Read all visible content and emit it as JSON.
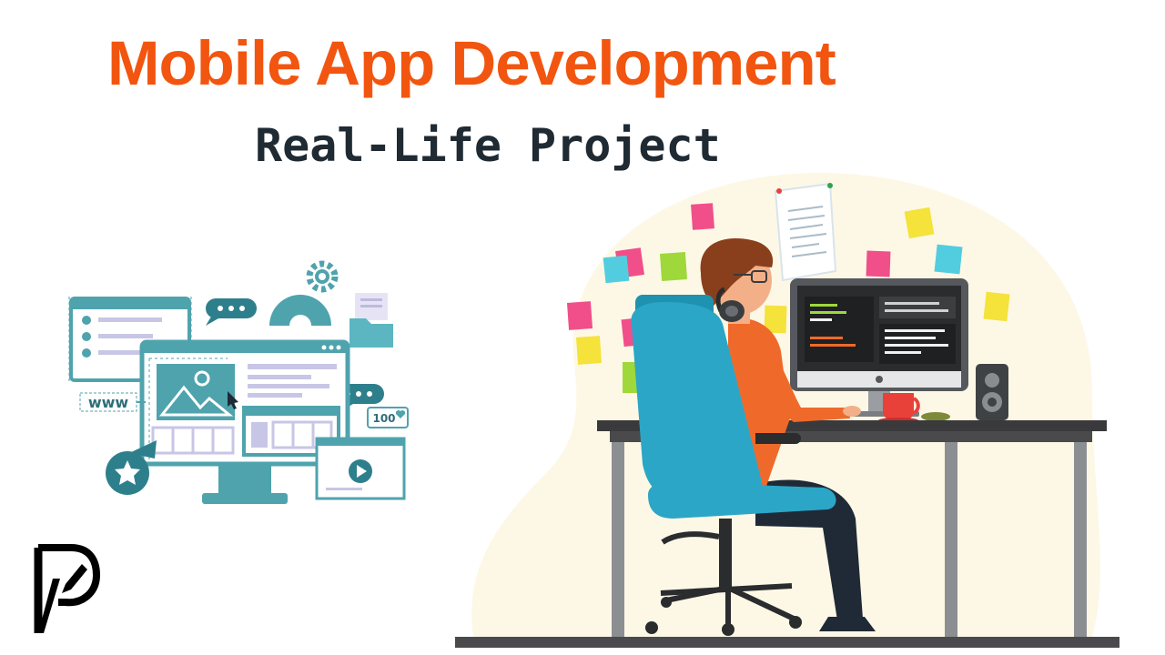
{
  "header": {
    "title": "Mobile App Development",
    "subtitle": "Real-Life Project"
  },
  "website_illustration": {
    "www_label": "www",
    "likes_label": "100"
  },
  "colors": {
    "title": "#f2550f",
    "subtitle": "#1f2a33",
    "teal": "#4fa3ad",
    "chair": "#2ba6c6",
    "shirt": "#ef6a2a",
    "hair": "#8a3f1c",
    "desk": "#3a3a3c",
    "mug": "#e8413a",
    "backdrop": "#fdf8e6"
  },
  "icons": {
    "logo": "p-rocket-logo",
    "gear": "gear-icon",
    "chat": "chat-bubble-icon",
    "star": "star-badge-icon",
    "play": "play-icon",
    "heart": "heart-icon",
    "folder": "folder-icon",
    "image": "image-icon",
    "cursor": "cursor-icon"
  }
}
